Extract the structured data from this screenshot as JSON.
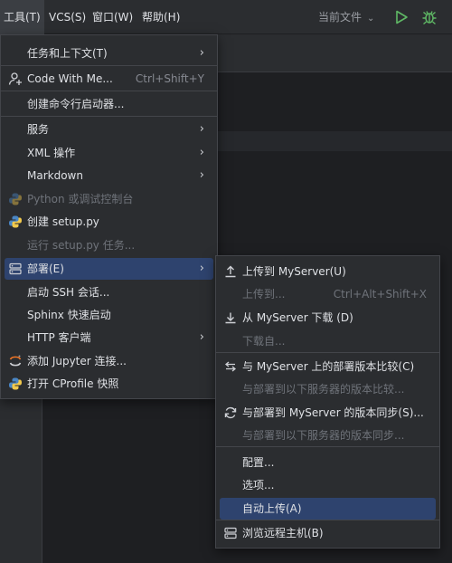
{
  "menubar": {
    "items": [
      "工具(T)",
      "VCS(S)",
      "窗口(W)",
      "帮助(H)"
    ],
    "run_config": "当前文件"
  },
  "tools_menu": {
    "items": [
      {
        "label": "任务和上下文(T)",
        "submenu": true
      },
      {
        "label": "Code With Me...",
        "shortcut": "Ctrl+Shift+Y",
        "icon": "person-add-icon"
      },
      {
        "label": "创建命令行启动器..."
      },
      {
        "label": "服务",
        "submenu": true
      },
      {
        "label": "XML 操作",
        "submenu": true
      },
      {
        "label": "Markdown",
        "submenu": true
      },
      {
        "label": "Python 或调试控制台",
        "disabled": true,
        "icon": "python-icon"
      },
      {
        "label": "创建 setup.py",
        "icon": "python-icon"
      },
      {
        "label": "运行 setup.py 任务...",
        "disabled": true
      },
      {
        "label": "部署(E)",
        "submenu": true,
        "selected": true,
        "icon": "server-icon"
      },
      {
        "label": "启动 SSH 会话..."
      },
      {
        "label": "Sphinx 快速启动"
      },
      {
        "label": "HTTP 客户端",
        "submenu": true
      },
      {
        "label": "添加 Jupyter 连接...",
        "icon": "jupyter-icon"
      },
      {
        "label": "打开 CProfile 快照",
        "icon": "python-icon"
      }
    ]
  },
  "deployment_menu": {
    "items": [
      {
        "label": "上传到 MyServer(U)",
        "icon": "upload-icon"
      },
      {
        "label": "上传到...",
        "shortcut": "Ctrl+Alt+Shift+X",
        "disabled": true
      },
      {
        "label": "从 MyServer 下载 (D)",
        "icon": "download-icon"
      },
      {
        "label": "下载自...",
        "disabled": true
      },
      {
        "label": "与 MyServer 上的部署版本比较(C)",
        "icon": "compare-icon"
      },
      {
        "label": "与部署到以下服务器的版本比较...",
        "disabled": true
      },
      {
        "label": "与部署到 MyServer 的版本同步(S)...",
        "icon": "sync-icon"
      },
      {
        "label": "与部署到以下服务器的版本同步...",
        "disabled": true
      },
      {
        "label": "配置..."
      },
      {
        "label": "选项..."
      },
      {
        "label": "自动上传(A)",
        "selected": true
      },
      {
        "label": "浏览远程主机(B)",
        "icon": "server-icon"
      }
    ]
  },
  "colors": {
    "background": "#1e1f22",
    "menu_background": "#2b2d30",
    "selection": "#2e436e",
    "run_green": "#5fb865",
    "python_blue": "#4a86c5",
    "python_yellow": "#f2c94c"
  }
}
